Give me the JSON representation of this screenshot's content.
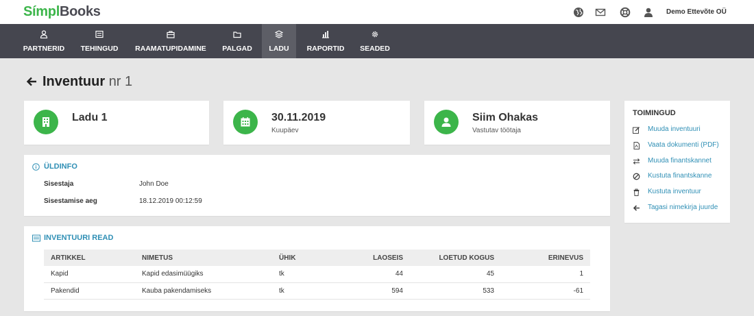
{
  "app": {
    "logo_part1": "Símpl",
    "logo_part2": "Books",
    "company": "Demo Ettevõte OÜ"
  },
  "icons": {
    "globe": "globe-icon",
    "mail": "mail-icon",
    "support": "lifebuoy-icon",
    "user": "user-icon"
  },
  "nav": {
    "items": [
      {
        "label": "PARTNERID",
        "icon": "partners-icon"
      },
      {
        "label": "TEHINGUD",
        "icon": "transactions-icon"
      },
      {
        "label": "RAAMATUPIDAMINE",
        "icon": "briefcase-icon"
      },
      {
        "label": "PALGAD",
        "icon": "folder-icon"
      },
      {
        "label": "LADU",
        "icon": "warehouse-icon",
        "active": true
      },
      {
        "label": "RAPORTID",
        "icon": "chart-icon"
      },
      {
        "label": "SEADED",
        "icon": "gear-icon"
      }
    ]
  },
  "page": {
    "title": "Inventuur",
    "subtitle": "nr 1"
  },
  "cards": {
    "warehouse": {
      "value": "Ladu 1"
    },
    "date": {
      "value": "30.11.2019",
      "label": "Kuupäev"
    },
    "person": {
      "value": "Siim Ohakas",
      "label": "Vastutav töötaja"
    }
  },
  "general": {
    "title": "ÜLDINFO",
    "fields": [
      {
        "label": "Sisestaja",
        "value": "John Doe"
      },
      {
        "label": "Sisestamise aeg",
        "value": "18.12.2019 00:12:59"
      }
    ]
  },
  "rows": {
    "title": "INVENTUURI READ",
    "headers": [
      "ARTIKKEL",
      "NIMETUS",
      "ÜHIK",
      "LAOSEIS",
      "LOETUD KOGUS",
      "ERINEVUS"
    ],
    "data": [
      [
        "Kapid",
        "Kapid edasimüügiks",
        "tk",
        "44",
        "45",
        "1"
      ],
      [
        "Pakendid",
        "Kauba pakendamiseks",
        "tk",
        "594",
        "533",
        "-61"
      ]
    ]
  },
  "actions": {
    "title": "TOIMINGUD",
    "items": [
      {
        "label": "Muuda inventuuri",
        "icon": "edit-icon"
      },
      {
        "label": "Vaata dokumenti (PDF)",
        "icon": "pdf-icon"
      },
      {
        "label": "Muuda finantskannet",
        "icon": "exchange-icon"
      },
      {
        "label": "Kustuta finantskanne",
        "icon": "ban-icon"
      },
      {
        "label": "Kustuta inventuur",
        "icon": "trash-icon"
      },
      {
        "label": "Tagasi nimekirja juurde",
        "icon": "arrow-left-icon"
      }
    ]
  },
  "colors": {
    "accent": "#3cb54a",
    "link": "#2f8fb5",
    "nav_bg": "#45464f",
    "nav_active": "#5d5e66"
  }
}
